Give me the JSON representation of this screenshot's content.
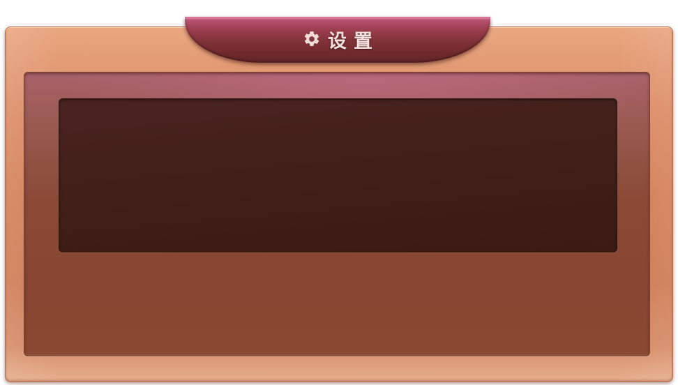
{
  "window": {
    "title": "设置",
    "title_icon": "gear-icon"
  },
  "content": {
    "display_text": ""
  },
  "colors": {
    "frame": "#d38058",
    "inner_panel": "#8a4a36",
    "display_box": "#3f1d17",
    "title_tab": "#7e3137",
    "title_text": "#f4e0dc"
  }
}
